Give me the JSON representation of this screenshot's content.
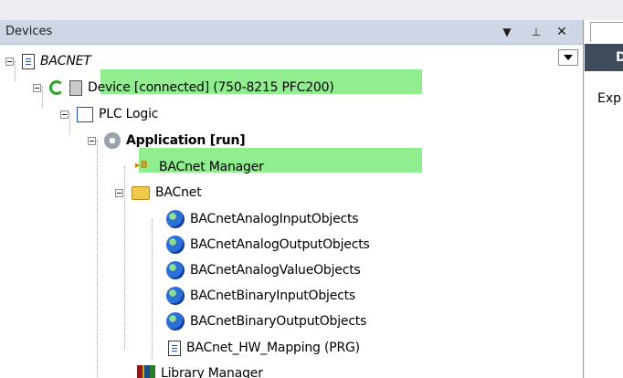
{
  "panel": {
    "title": "Devices",
    "dropdown_icon": "chevron-down-icon",
    "pin_icon": "pin-icon",
    "close_icon": "close-icon"
  },
  "tree": [
    {
      "label": "BACNET",
      "icon": "project-icon",
      "style": "italic"
    },
    {
      "label": "Device [connected] (750-8215 PFC200)",
      "icon": "device-icon",
      "highlight": "#90ee90"
    },
    {
      "label": "PLC Logic",
      "icon": "plc-logic-icon"
    },
    {
      "label": "Application [run]",
      "icon": "application-gear-icon",
      "highlight": "#90ee90",
      "style": "bold"
    },
    {
      "label": "BACnet Manager",
      "icon": "bacnet-manager-icon"
    },
    {
      "label": "BACnet",
      "icon": "folder-icon"
    },
    {
      "label": "BACnetAnalogInputObjects",
      "icon": "globe-icon"
    },
    {
      "label": "BACnetAnalogOutputObjects",
      "icon": "globe-icon"
    },
    {
      "label": "BACnetAnalogValueObjects",
      "icon": "globe-icon"
    },
    {
      "label": "BACnetBinaryInputObjects",
      "icon": "globe-icon"
    },
    {
      "label": "BACnetBinaryOutputObjects",
      "icon": "globe-icon"
    },
    {
      "label": "BACnet_HW_Mapping (PRG)",
      "icon": "document-icon"
    },
    {
      "label": "Library Manager",
      "icon": "library-icon"
    }
  ],
  "right_panel": {
    "header": "D",
    "text": "Exp"
  }
}
